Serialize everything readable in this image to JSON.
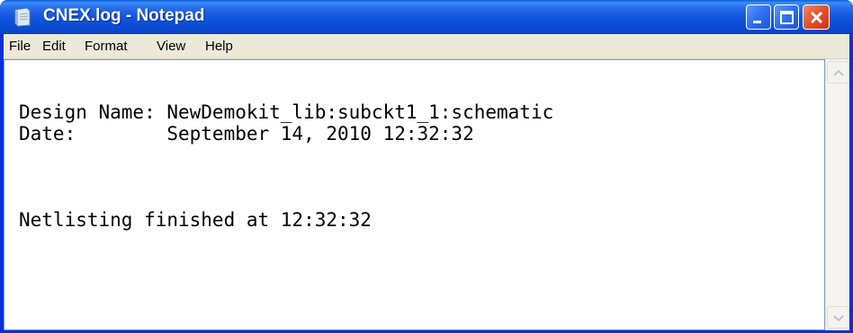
{
  "window": {
    "title": "CNEX.log - Notepad",
    "app_icon": "notepad-icon"
  },
  "title_buttons": {
    "minimize_icon": "minimize-icon",
    "maximize_icon": "maximize-icon",
    "close_icon": "close-icon"
  },
  "menu": {
    "file": "File",
    "edit": "Edit",
    "format": "Format",
    "view": "View",
    "help": "Help"
  },
  "editor": {
    "content": "Design Name: NewDemokit_lib:subckt1_1:schematic\nDate:        September 14, 2010 12:32:32\n\n\n\nNetlisting finished at 12:32:32"
  },
  "scrollbar": {
    "up_icon": "scroll-up-arrow-icon",
    "down_icon": "scroll-down-arrow-icon"
  },
  "colors": {
    "titlebar": "#0a4fd6",
    "close_button": "#e2512a",
    "menubar": "#ece9d8",
    "editor_bg": "#ffffff"
  }
}
